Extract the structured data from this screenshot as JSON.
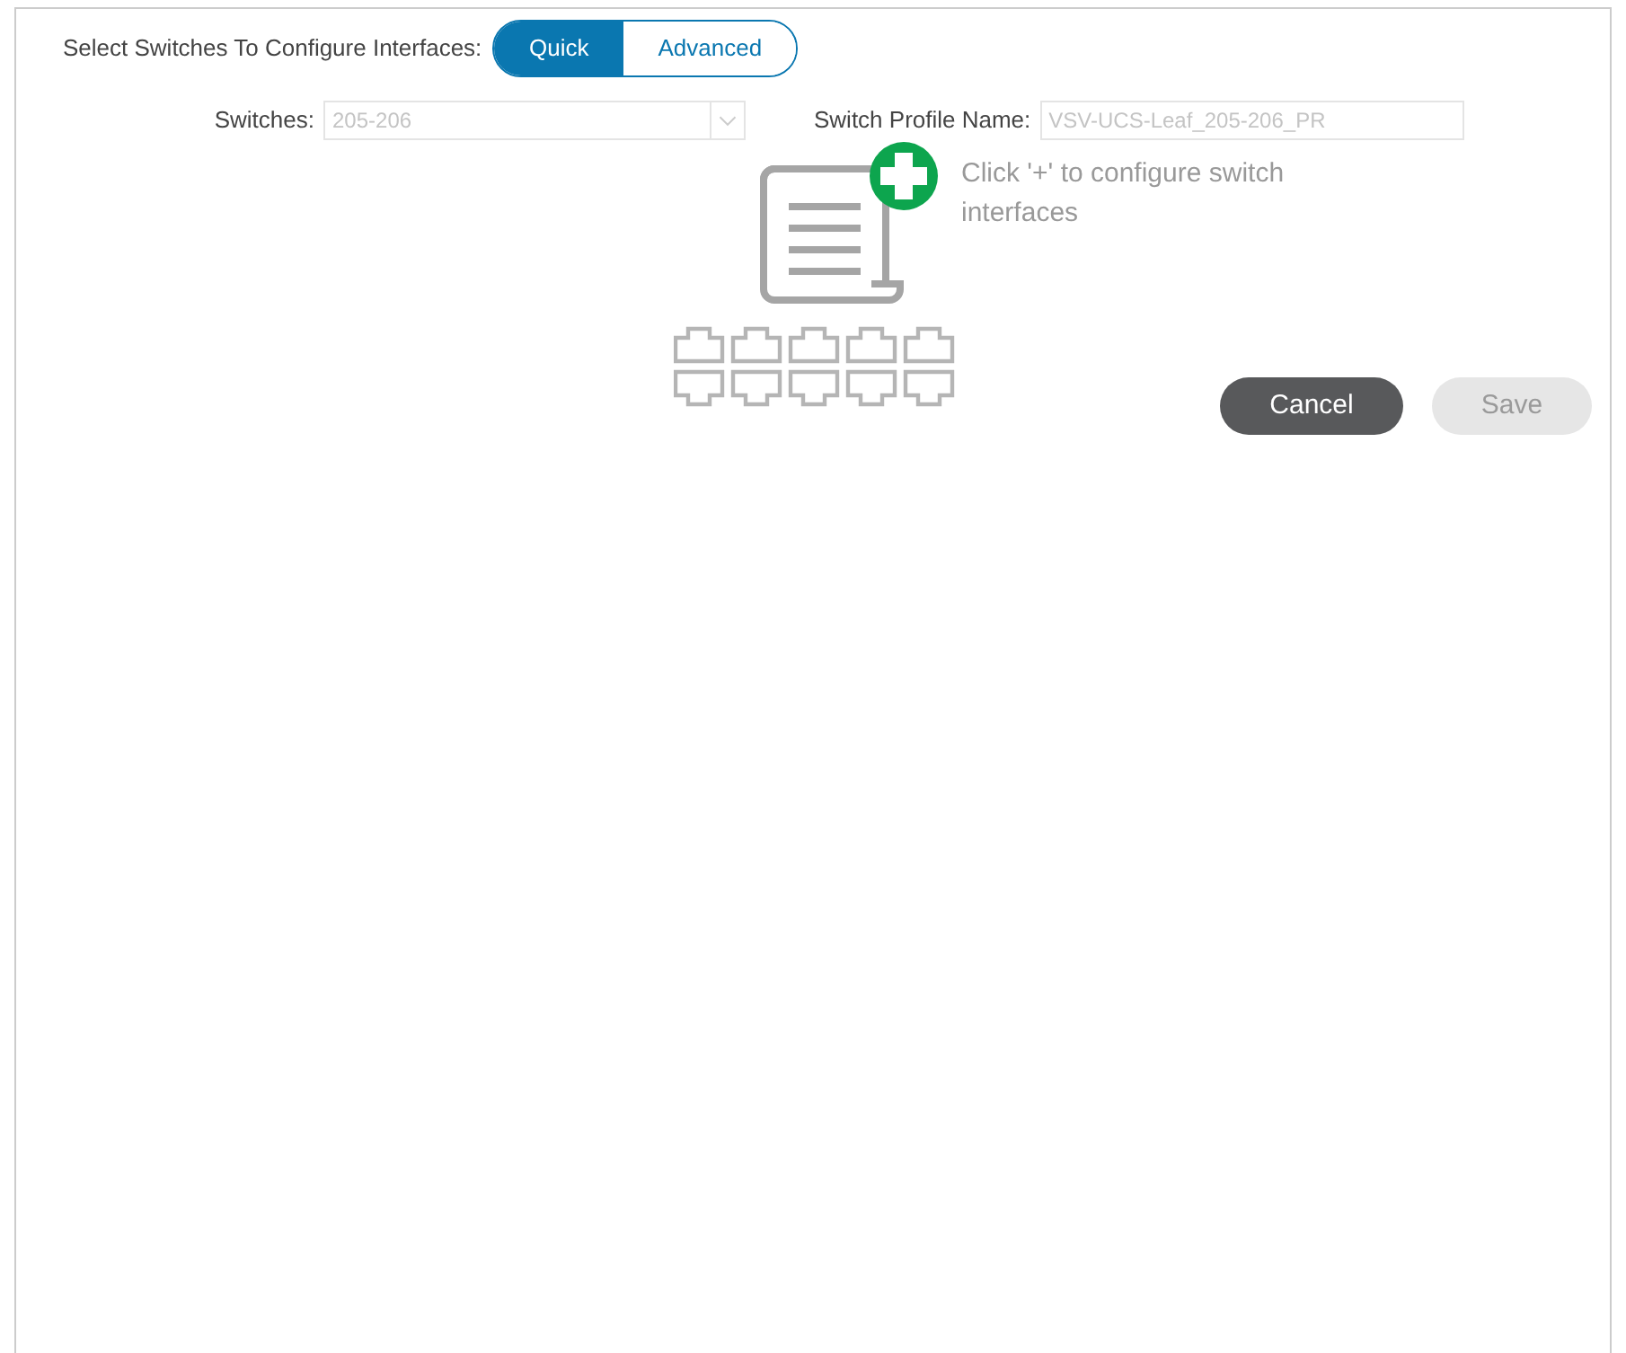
{
  "mode_selector": {
    "label": "Select Switches To Configure Interfaces:",
    "options": [
      {
        "label": "Quick",
        "selected": true
      },
      {
        "label": "Advanced",
        "selected": false
      }
    ]
  },
  "switches": {
    "label": "Switches:",
    "value": "205-206",
    "disabled": true
  },
  "profile_name": {
    "label": "Switch Profile Name:",
    "value": "VSV-UCS-Leaf_205-206_PR",
    "disabled": true
  },
  "empty_state": {
    "hint": "Click '+' to configure switch interfaces"
  },
  "buttons": [
    {
      "label": "Cancel",
      "disabled": false
    },
    {
      "label": "Save",
      "disabled": true
    }
  ]
}
